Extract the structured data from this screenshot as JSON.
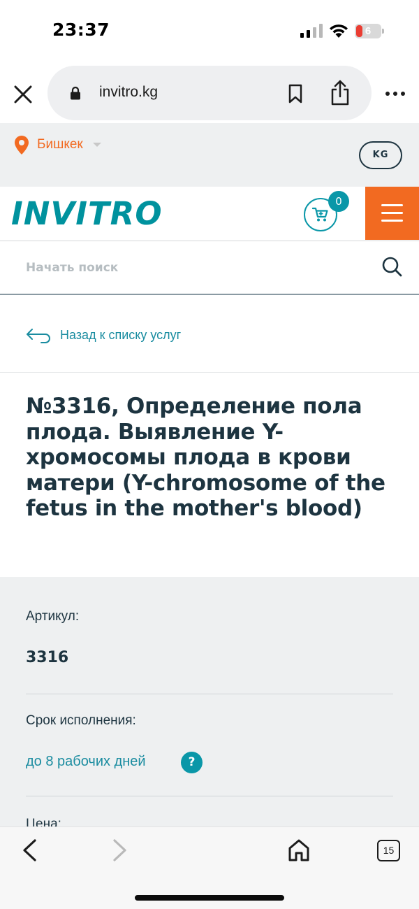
{
  "status": {
    "time": "23:37",
    "battery_level": "6"
  },
  "browser": {
    "url": "invitro.kg",
    "open_tabs": "15"
  },
  "location": {
    "city": "Бишкек",
    "language": "KG"
  },
  "header": {
    "logo": "INVITRO",
    "cart_count": "0"
  },
  "search": {
    "placeholder": "Начать поиск"
  },
  "nav": {
    "back_link": "Назад к списку услуг"
  },
  "service": {
    "title": "№3316, Определение пола плода. Выявление Y-хромосомы плода в крови матери (Y-chromosome of the fetus in the mother's blood)",
    "article_label": "Артикул:",
    "article_value": "3316",
    "duration_label": "Срок исполнения:",
    "duration_value": "до 8 рабочих дней",
    "help_glyph": "?",
    "price_label": "Цена:"
  },
  "colors": {
    "brand_teal": "#00929e",
    "accent_orange": "#f26a21",
    "text_dark": "#1d3440"
  }
}
